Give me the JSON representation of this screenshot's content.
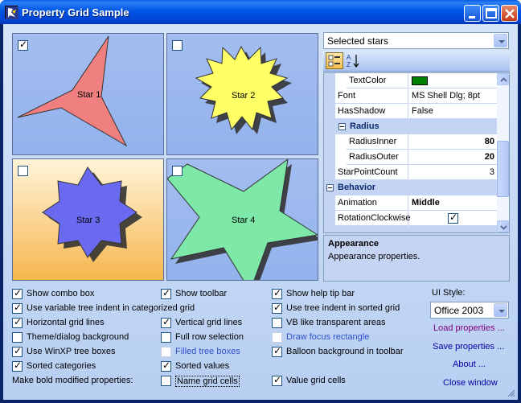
{
  "window": {
    "title": "Property Grid Sample"
  },
  "stars": [
    {
      "label": "Star 1",
      "checked": true,
      "fill": "#f08080"
    },
    {
      "label": "Star 2",
      "checked": false,
      "fill": "#ffff66"
    },
    {
      "label": "Star 3",
      "checked": false,
      "fill": "#6a6af0"
    },
    {
      "label": "Star 4",
      "checked": false,
      "fill": "#7ee8a8"
    }
  ],
  "selector": {
    "value": "Selected stars"
  },
  "grid": {
    "rows": [
      {
        "kind": "prop",
        "name": "TextColor",
        "value": "",
        "swatch": "#008000"
      },
      {
        "kind": "prop",
        "name": "Font",
        "value": "MS Shell Dlg; 8pt"
      },
      {
        "kind": "prop",
        "name": "HasShadow",
        "value": "False"
      },
      {
        "kind": "subcat",
        "name": "Radius"
      },
      {
        "kind": "prop",
        "name": "RadiusInner",
        "value": "80"
      },
      {
        "kind": "prop",
        "name": "RadiusOuter",
        "value": "20"
      },
      {
        "kind": "prop",
        "name": "StarPointCount",
        "value": "3"
      },
      {
        "kind": "cat",
        "name": "Behavior"
      },
      {
        "kind": "prop",
        "name": "Animation",
        "value": "Middle"
      },
      {
        "kind": "prop",
        "name": "RotationClockwise",
        "value": "",
        "checked": true
      }
    ]
  },
  "help": {
    "title": "Appearance",
    "description": "Appearance properties."
  },
  "options": {
    "col1": [
      {
        "label": "Show combo box",
        "checked": true
      },
      {
        "label": "Use variable tree indent in categorized grid",
        "checked": true
      },
      {
        "label": "Horizontal grid lines",
        "checked": true
      },
      {
        "label": "Theme/dialog background",
        "checked": false
      },
      {
        "label": "Use WinXP tree boxes",
        "checked": true
      },
      {
        "label": "Sorted categories",
        "checked": true
      }
    ],
    "col2": [
      {
        "label": "Show toolbar",
        "checked": true
      },
      {
        "label": "Vertical grid lines",
        "checked": true
      },
      {
        "label": "Full row selection",
        "checked": false
      },
      {
        "label": "Filled tree boxes",
        "checked": false
      },
      {
        "label": "Sorted values",
        "checked": true
      },
      {
        "label": "Name grid cells",
        "checked": false
      }
    ],
    "col3": [
      {
        "label": "Show help tip bar",
        "checked": true
      },
      {
        "label": "Use tree indent in sorted grid",
        "checked": true
      },
      {
        "label": "VB like transparent areas",
        "checked": false
      },
      {
        "label": "Draw focus rectangle",
        "checked": false
      },
      {
        "label": "Balloon background in toolbar",
        "checked": true
      },
      {
        "label": "Value grid cells",
        "checked": true
      }
    ],
    "bold_label": "Make bold modified properties:"
  },
  "ui_style": {
    "label": "UI Style:",
    "value": "Office 2003"
  },
  "links": {
    "load": "Load properties ...",
    "save": "Save properties ...",
    "about": "About ...",
    "close": "Close window"
  }
}
